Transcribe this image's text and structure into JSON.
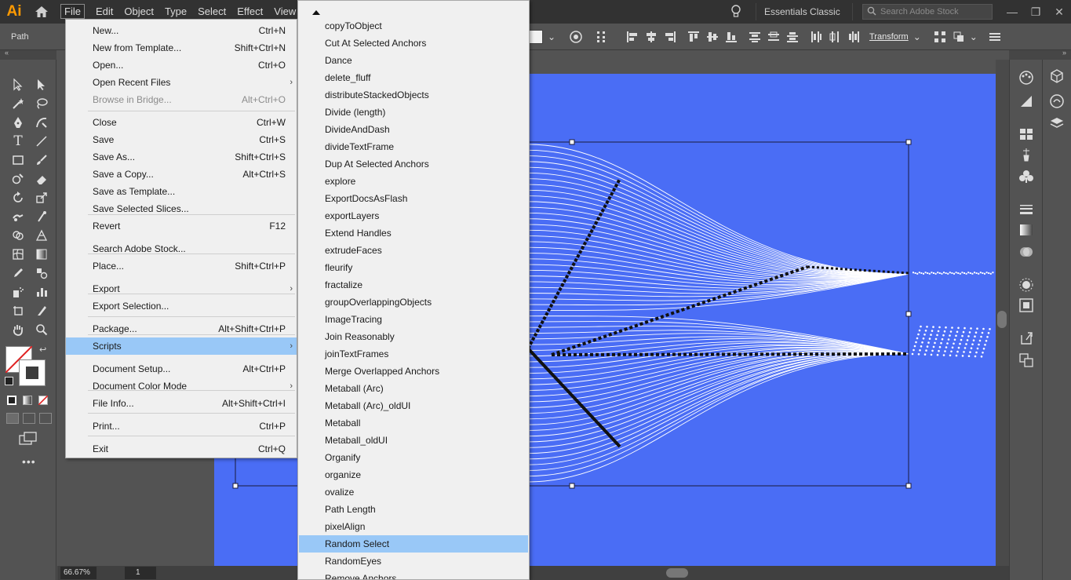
{
  "app": {
    "logo": "Ai"
  },
  "menubar": {
    "items": [
      "File",
      "Edit",
      "Object",
      "Type",
      "Select",
      "Effect",
      "View"
    ],
    "workspace": "Essentials Classic",
    "search_placeholder": "Search Adobe Stock"
  },
  "controlbar": {
    "selection_label": "Path",
    "transform_label": "Transform"
  },
  "file_menu": {
    "items": [
      {
        "label": "New...",
        "shortcut": "Ctrl+N"
      },
      {
        "label": "New from Template...",
        "shortcut": "Shift+Ctrl+N"
      },
      {
        "label": "Open...",
        "shortcut": "Ctrl+O"
      },
      {
        "label": "Open Recent Files",
        "shortcut": ""
      },
      {
        "label": "Browse in Bridge...",
        "shortcut": "Alt+Ctrl+O"
      },
      {
        "label": "Close",
        "shortcut": "Ctrl+W"
      },
      {
        "label": "Save",
        "shortcut": "Ctrl+S"
      },
      {
        "label": "Save As...",
        "shortcut": "Shift+Ctrl+S"
      },
      {
        "label": "Save a Copy...",
        "shortcut": "Alt+Ctrl+S"
      },
      {
        "label": "Save as Template...",
        "shortcut": ""
      },
      {
        "label": "Save Selected Slices...",
        "shortcut": ""
      },
      {
        "label": "Revert",
        "shortcut": "F12"
      },
      {
        "label": "Search Adobe Stock...",
        "shortcut": ""
      },
      {
        "label": "Place...",
        "shortcut": "Shift+Ctrl+P"
      },
      {
        "label": "Export",
        "shortcut": ""
      },
      {
        "label": "Export Selection...",
        "shortcut": ""
      },
      {
        "label": "Package...",
        "shortcut": "Alt+Shift+Ctrl+P"
      },
      {
        "label": "Scripts",
        "shortcut": ""
      },
      {
        "label": "Document Setup...",
        "shortcut": "Alt+Ctrl+P"
      },
      {
        "label": "Document Color Mode",
        "shortcut": ""
      },
      {
        "label": "File Info...",
        "shortcut": "Alt+Shift+Ctrl+I"
      },
      {
        "label": "Print...",
        "shortcut": "Ctrl+P"
      },
      {
        "label": "Exit",
        "shortcut": "Ctrl+Q"
      }
    ]
  },
  "scripts_menu": {
    "items": [
      "copyToObject",
      "Cut At Selected Anchors",
      "Dance",
      "delete_fluff",
      "distributeStackedObjects",
      "Divide (length)",
      "DivideAndDash",
      "divideTextFrame",
      "Dup At Selected Anchors",
      "explore",
      "ExportDocsAsFlash",
      "exportLayers",
      "Extend Handles",
      "extrudeFaces",
      "fleurify",
      "fractalize",
      "groupOverlappingObjects",
      "ImageTracing",
      "Join Reasonably",
      "joinTextFrames",
      "Merge Overlapped Anchors",
      "Metaball (Arc)",
      "Metaball (Arc)_oldUI",
      "Metaball",
      "Metaball_oldUI",
      "Organify",
      "organize",
      "ovalize",
      "Path Length",
      "pixelAlign",
      "Random Select",
      "RandomEyes",
      "Remove Anchors"
    ],
    "highlighted": "Random Select"
  },
  "statusbar": {
    "zoom": "66.67%",
    "page": "1"
  },
  "colors": {
    "artboard": "#4a6df5",
    "menu_highlight": "#99c8f7",
    "chrome_dark": "#323232",
    "chrome": "#535353"
  }
}
